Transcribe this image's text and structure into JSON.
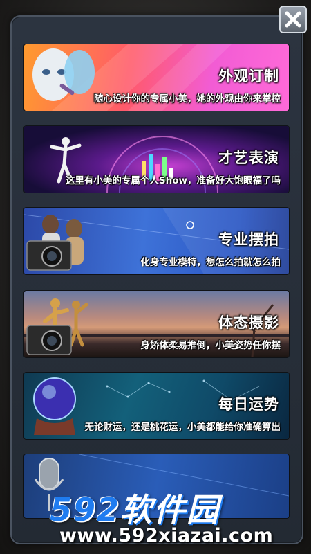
{
  "cards": [
    {
      "title": "外观订制",
      "desc": "随心设计你的专属小美，她的外观由你来掌控"
    },
    {
      "title": "才艺表演",
      "desc": "这里有小美的专属个人Show，准备好大饱眼福了吗"
    },
    {
      "title": "专业摆拍",
      "desc": "化身专业模特，想怎么拍就怎么拍"
    },
    {
      "title": "体态摄影",
      "desc": "身娇体柔易推倒，小美姿势任你摆"
    },
    {
      "title": "每日运势",
      "desc": "无论财运，还是桃花运，小美都能给你准确算出"
    },
    {
      "title": "",
      "desc": ""
    }
  ],
  "watermark": {
    "logo_num": "592",
    "logo_cn": "软件园",
    "url": "www.592xiazai.com"
  },
  "icons": {
    "close": "close-icon"
  }
}
